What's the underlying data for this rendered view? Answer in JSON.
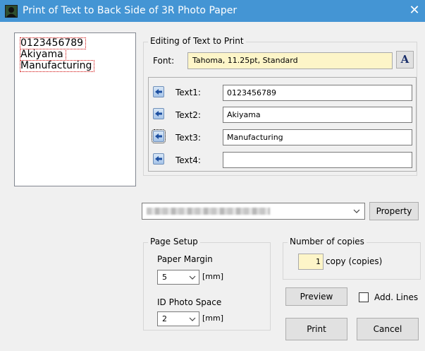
{
  "window": {
    "title": "Print of Text to Back Side of 3R Photo Paper",
    "close": "✕"
  },
  "preview": {
    "lines": [
      "0123456789",
      "Akiyama",
      "Manufacturing"
    ]
  },
  "editing": {
    "legend": "Editing of Text to Print",
    "font_label": "Font:",
    "font_value": "Tahoma, 11.25pt, Standard",
    "font_button": "A",
    "rows": [
      {
        "label": "Text1:",
        "value": "0123456789"
      },
      {
        "label": "Text2:",
        "value": "Akiyama"
      },
      {
        "label": "Text3:",
        "value": "Manufacturing"
      },
      {
        "label": "Text4:",
        "value": ""
      }
    ]
  },
  "printer": {
    "property_button": "Property"
  },
  "page_setup": {
    "legend": "Page Setup",
    "margin_label": "Paper Margin",
    "margin_value": "5",
    "margin_unit": "[mm]",
    "id_label": "ID Photo Space",
    "id_value": "2",
    "id_unit": "[mm]"
  },
  "copies": {
    "legend": "Number of copies",
    "value": "1",
    "unit": "copy (copies)"
  },
  "buttons": {
    "preview": "Preview",
    "add_lines": "Add. Lines",
    "print": "Print",
    "cancel": "Cancel"
  },
  "colors": {
    "titlebar": "#4495d4",
    "input_highlight": "#fdf5c8",
    "preview_outline": "#d00000"
  }
}
